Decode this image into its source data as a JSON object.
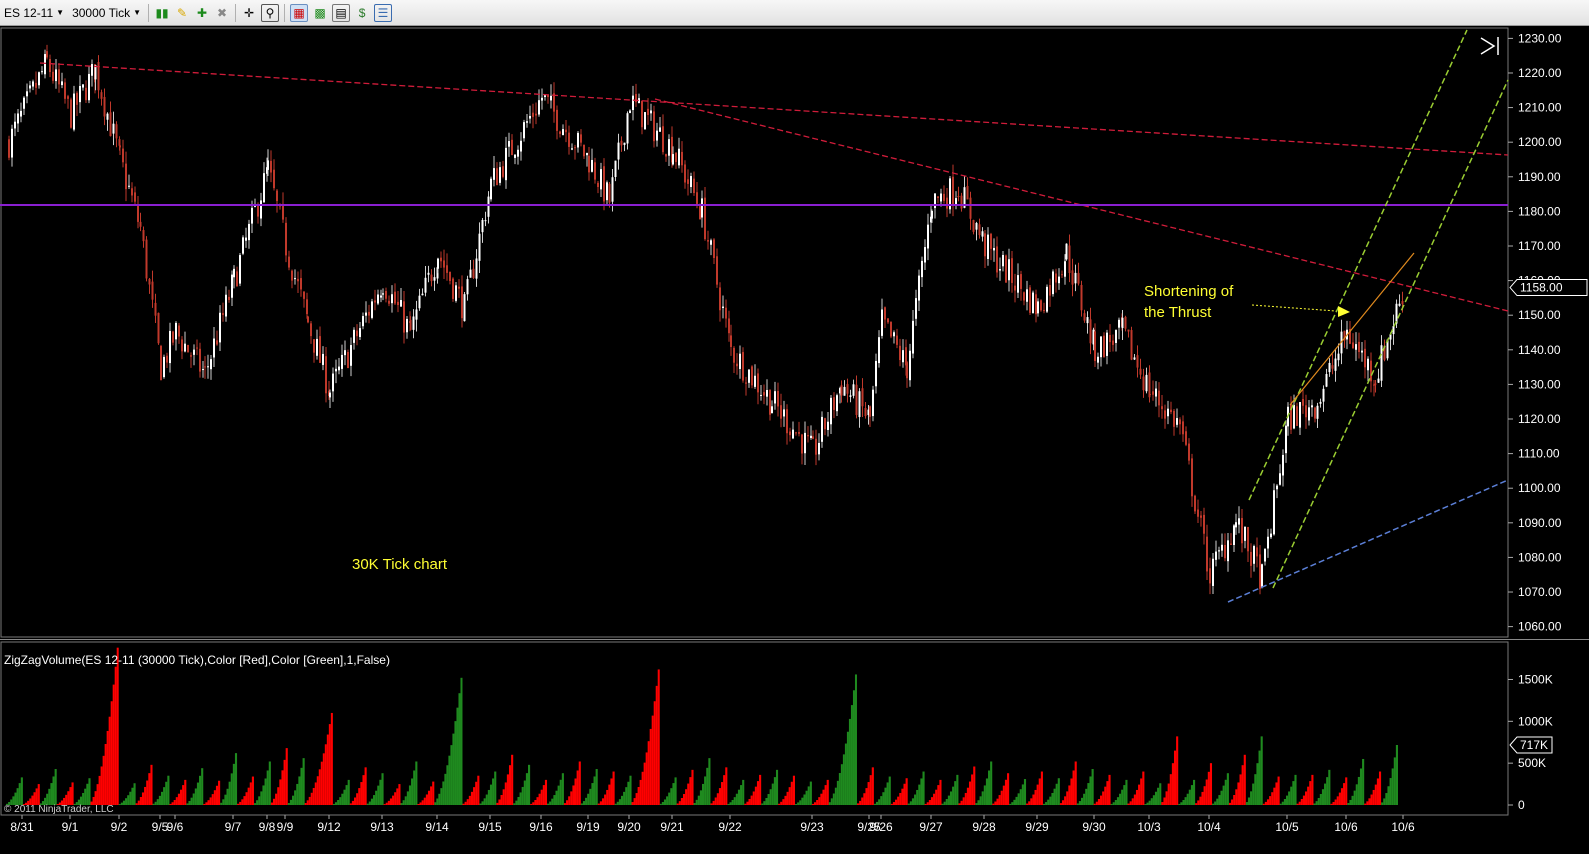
{
  "toolbar": {
    "instrument": "ES 12-11",
    "interval": "30000 Tick"
  },
  "annotations": {
    "thrust_line1": "Shortening of",
    "thrust_line2": "the Thrust",
    "chart_label": "30K Tick chart",
    "indicator_label": "ZigZagVolume(ES 12-11 (30000 Tick),Color [Red],Color [Green],1,False)",
    "copyright": "© 2011 NinjaTrader, LLC"
  },
  "colors": {
    "background": "#000000",
    "up_candle": "#ffffff",
    "down_candle": "#c0392b",
    "resistance_line": "#d01c3a",
    "horizontal_line": "#8a1fd0",
    "channel_lines": "#9acd32",
    "support_line": "#5b7fd6",
    "thrust_line": "#e08a1e",
    "annotation_text": "#ffff33",
    "volume_up": "#1f8a1f",
    "volume_down": "#ff0000"
  },
  "chart_data": [
    {
      "type": "candlestick",
      "instrument": "ES 12-11",
      "interval": "30000 Tick",
      "x_tick_labels": [
        "8/31",
        "9/1",
        "9/2",
        "9/5",
        "9/6",
        "9/7",
        "9/8",
        "9/9",
        "9/12",
        "9/13",
        "9/14",
        "9/15",
        "9/16",
        "9/19",
        "9/20",
        "9/21",
        "9/22",
        "9/23",
        "9/25",
        "9/26",
        "9/27",
        "9/28",
        "9/29",
        "9/30",
        "10/3",
        "10/4",
        "10/5",
        "10/6",
        "10/6"
      ],
      "y_ticks": [
        1060,
        1070,
        1080,
        1090,
        1100,
        1110,
        1120,
        1130,
        1140,
        1150,
        1160,
        1170,
        1180,
        1190,
        1200,
        1210,
        1220,
        1230
      ],
      "ylim": [
        1057,
        1233
      ],
      "last_price": "1158.00",
      "close_path": [
        {
          "day": "8/31",
          "close": 1200
        },
        {
          "day": "8/31",
          "close": 1223
        },
        {
          "day": "9/1",
          "close": 1208
        },
        {
          "day": "9/1",
          "close": 1221
        },
        {
          "day": "9/2",
          "close": 1195
        },
        {
          "day": "9/2",
          "close": 1175
        },
        {
          "day": "9/5",
          "close": 1135
        },
        {
          "day": "9/6",
          "close": 1145
        },
        {
          "day": "9/6",
          "close": 1133
        },
        {
          "day": "9/7",
          "close": 1160
        },
        {
          "day": "9/8",
          "close": 1192
        },
        {
          "day": "9/9",
          "close": 1170
        },
        {
          "day": "9/9",
          "close": 1148
        },
        {
          "day": "9/12",
          "close": 1128
        },
        {
          "day": "9/13",
          "close": 1160
        },
        {
          "day": "9/13",
          "close": 1145
        },
        {
          "day": "9/14",
          "close": 1168
        },
        {
          "day": "9/14",
          "close": 1152
        },
        {
          "day": "9/15",
          "close": 1188
        },
        {
          "day": "9/16",
          "close": 1213
        },
        {
          "day": "9/19",
          "close": 1195
        },
        {
          "day": "9/19",
          "close": 1183
        },
        {
          "day": "9/20",
          "close": 1212
        },
        {
          "day": "9/21",
          "close": 1198
        },
        {
          "day": "9/21",
          "close": 1180
        },
        {
          "day": "9/22",
          "close": 1140
        },
        {
          "day": "9/22",
          "close": 1125
        },
        {
          "day": "9/23",
          "close": 1110
        },
        {
          "day": "9/23",
          "close": 1130
        },
        {
          "day": "9/25",
          "close": 1120
        },
        {
          "day": "9/26",
          "close": 1148
        },
        {
          "day": "9/26",
          "close": 1135
        },
        {
          "day": "9/27",
          "close": 1183
        },
        {
          "day": "9/27",
          "close": 1187
        },
        {
          "day": "9/28",
          "close": 1170
        },
        {
          "day": "9/29",
          "close": 1152
        },
        {
          "day": "9/29",
          "close": 1168
        },
        {
          "day": "9/30",
          "close": 1140
        },
        {
          "day": "9/30",
          "close": 1145
        },
        {
          "day": "10/3",
          "close": 1128
        },
        {
          "day": "10/3",
          "close": 1118
        },
        {
          "day": "10/4",
          "close": 1075
        },
        {
          "day": "10/4",
          "close": 1090
        },
        {
          "day": "10/4",
          "close": 1074
        },
        {
          "day": "10/5",
          "close": 1120
        },
        {
          "day": "10/5",
          "close": 1125
        },
        {
          "day": "10/6",
          "close": 1145
        },
        {
          "day": "10/6",
          "close": 1132
        },
        {
          "day": "10/6",
          "close": 1158
        }
      ],
      "drawn_lines": [
        {
          "name": "upper trendline",
          "from": {
            "day": "8/31",
            "price": 1223
          },
          "to": {
            "day": "10/6",
            "price": 1197
          }
        },
        {
          "name": "lower trendline",
          "from": {
            "day": "9/21",
            "price": 1212
          },
          "to": {
            "day": "10/6",
            "price": 1152
          }
        },
        {
          "name": "horizontal level",
          "price": 1182
        },
        {
          "name": "support trendline",
          "from": {
            "day": "10/4",
            "price": 1067
          },
          "to": {
            "day": "10/6",
            "price": 1103
          }
        }
      ]
    },
    {
      "type": "bar",
      "title": "ZigZagVolume(ES 12-11 (30000 Tick),Color [Red],Color [Green],1,False)",
      "y_ticks": [
        0,
        500,
        1000,
        1500
      ],
      "y_tick_labels": [
        "0",
        "500K",
        "1000K",
        "1500K"
      ],
      "ylim": [
        0,
        1900
      ],
      "last_value": "717K",
      "legs": [
        {
          "dir": "up",
          "peak": 330
        },
        {
          "dir": "down",
          "peak": 250
        },
        {
          "dir": "up",
          "peak": 430
        },
        {
          "dir": "down",
          "peak": 270
        },
        {
          "dir": "up",
          "peak": 320
        },
        {
          "dir": "down",
          "peak": 1880
        },
        {
          "dir": "up",
          "peak": 260
        },
        {
          "dir": "down",
          "peak": 480
        },
        {
          "dir": "up",
          "peak": 350
        },
        {
          "dir": "down",
          "peak": 300
        },
        {
          "dir": "up",
          "peak": 440
        },
        {
          "dir": "down",
          "peak": 290
        },
        {
          "dir": "up",
          "peak": 620
        },
        {
          "dir": "down",
          "peak": 340
        },
        {
          "dir": "up",
          "peak": 520
        },
        {
          "dir": "down",
          "peak": 680
        },
        {
          "dir": "up",
          "peak": 560
        },
        {
          "dir": "down",
          "peak": 1100
        },
        {
          "dir": "up",
          "peak": 300
        },
        {
          "dir": "down",
          "peak": 450
        },
        {
          "dir": "up",
          "peak": 380
        },
        {
          "dir": "down",
          "peak": 250
        },
        {
          "dir": "up",
          "peak": 520
        },
        {
          "dir": "down",
          "peak": 280
        },
        {
          "dir": "up",
          "peak": 1520
        },
        {
          "dir": "down",
          "peak": 350
        },
        {
          "dir": "up",
          "peak": 400
        },
        {
          "dir": "down",
          "peak": 600
        },
        {
          "dir": "up",
          "peak": 480
        },
        {
          "dir": "down",
          "peak": 300
        },
        {
          "dir": "up",
          "peak": 380
        },
        {
          "dir": "down",
          "peak": 520
        },
        {
          "dir": "up",
          "peak": 430
        },
        {
          "dir": "down",
          "peak": 400
        },
        {
          "dir": "up",
          "peak": 350
        },
        {
          "dir": "down",
          "peak": 1620
        },
        {
          "dir": "up",
          "peak": 330
        },
        {
          "dir": "down",
          "peak": 420
        },
        {
          "dir": "up",
          "peak": 560
        },
        {
          "dir": "down",
          "peak": 450
        },
        {
          "dir": "up",
          "peak": 300
        },
        {
          "dir": "down",
          "peak": 360
        },
        {
          "dir": "up",
          "peak": 420
        },
        {
          "dir": "down",
          "peak": 350
        },
        {
          "dir": "up",
          "peak": 280
        },
        {
          "dir": "down",
          "peak": 300
        },
        {
          "dir": "up",
          "peak": 1560
        },
        {
          "dir": "down",
          "peak": 450
        },
        {
          "dir": "up",
          "peak": 340
        },
        {
          "dir": "down",
          "peak": 320
        },
        {
          "dir": "up",
          "peak": 400
        },
        {
          "dir": "down",
          "peak": 300
        },
        {
          "dir": "up",
          "peak": 360
        },
        {
          "dir": "down",
          "peak": 460
        },
        {
          "dir": "up",
          "peak": 520
        },
        {
          "dir": "down",
          "peak": 380
        },
        {
          "dir": "up",
          "peak": 310
        },
        {
          "dir": "down",
          "peak": 400
        },
        {
          "dir": "up",
          "peak": 320
        },
        {
          "dir": "down",
          "peak": 520
        },
        {
          "dir": "up",
          "peak": 430
        },
        {
          "dir": "down",
          "peak": 360
        },
        {
          "dir": "up",
          "peak": 300
        },
        {
          "dir": "down",
          "peak": 400
        },
        {
          "dir": "up",
          "peak": 260
        },
        {
          "dir": "down",
          "peak": 820
        },
        {
          "dir": "up",
          "peak": 300
        },
        {
          "dir": "down",
          "peak": 500
        },
        {
          "dir": "up",
          "peak": 380
        },
        {
          "dir": "down",
          "peak": 600
        },
        {
          "dir": "up",
          "peak": 820
        },
        {
          "dir": "down",
          "peak": 340
        },
        {
          "dir": "up",
          "peak": 360
        },
        {
          "dir": "down",
          "peak": 360
        },
        {
          "dir": "up",
          "peak": 420
        },
        {
          "dir": "down",
          "peak": 330
        },
        {
          "dir": "up",
          "peak": 550
        },
        {
          "dir": "down",
          "peak": 400
        },
        {
          "dir": "up",
          "peak": 717
        }
      ]
    }
  ]
}
